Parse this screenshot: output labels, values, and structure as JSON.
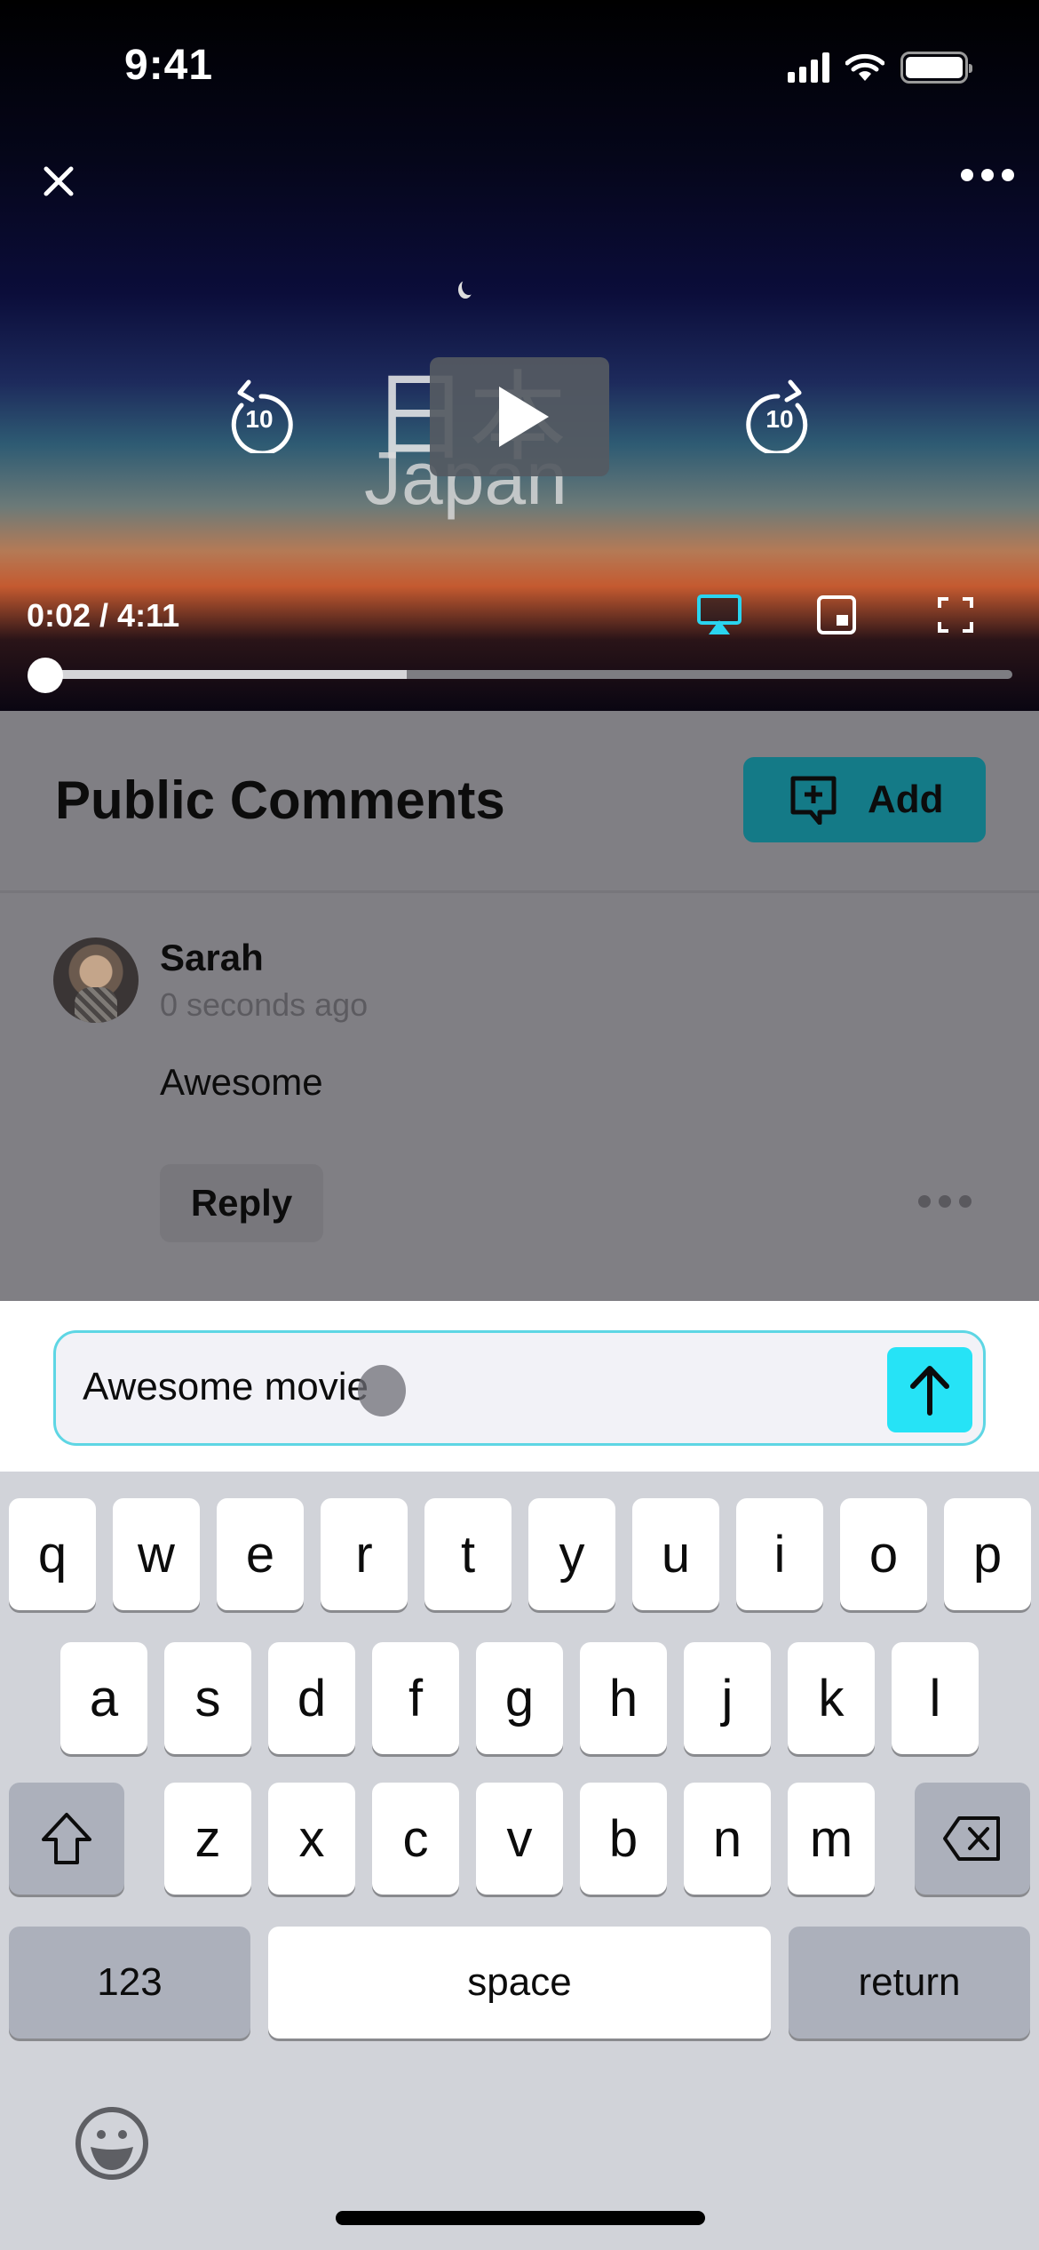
{
  "status_bar": {
    "time": "9:41",
    "signal_icon": "cellular-signal-icon",
    "wifi_icon": "wifi-icon",
    "battery_icon": "battery-icon"
  },
  "video": {
    "title_kanji": "日本",
    "title_latin": "Japan",
    "close_icon": "close-icon",
    "more_icon": "more-options-icon",
    "seek_back_label": "10",
    "seek_forward_label": "10",
    "play_icon": "play-icon",
    "time_display": "0:02 / 4:11",
    "current_time": "0:02",
    "duration": "4:11",
    "playback_progress": 0.008,
    "buffered_progress": 0.38,
    "airplay_icon": "airplay-icon",
    "airplay_color": "#2ad4ef",
    "pip_icon": "picture-in-picture-icon",
    "fullscreen_icon": "fullscreen-icon"
  },
  "comments": {
    "title": "Public Comments",
    "add_button_label": "Add",
    "add_button_color": "#147a87",
    "items": [
      {
        "author": "Sarah",
        "time_ago": "0 seconds ago",
        "text": "Awesome",
        "reply_label": "Reply"
      }
    ]
  },
  "composer": {
    "value": "Awesome movie",
    "accent_color": "#26e3f6",
    "send_icon": "arrow-up-icon"
  },
  "keyboard": {
    "row1": [
      "q",
      "w",
      "e",
      "r",
      "t",
      "y",
      "u",
      "i",
      "o",
      "p"
    ],
    "row2": [
      "a",
      "s",
      "d",
      "f",
      "g",
      "h",
      "j",
      "k",
      "l"
    ],
    "row3": [
      "z",
      "x",
      "c",
      "v",
      "b",
      "n",
      "m"
    ],
    "numbers_label": "123",
    "space_label": "space",
    "return_label": "return",
    "shift_icon": "shift-icon",
    "delete_icon": "backspace-icon",
    "emoji_icon": "emoji-icon"
  }
}
